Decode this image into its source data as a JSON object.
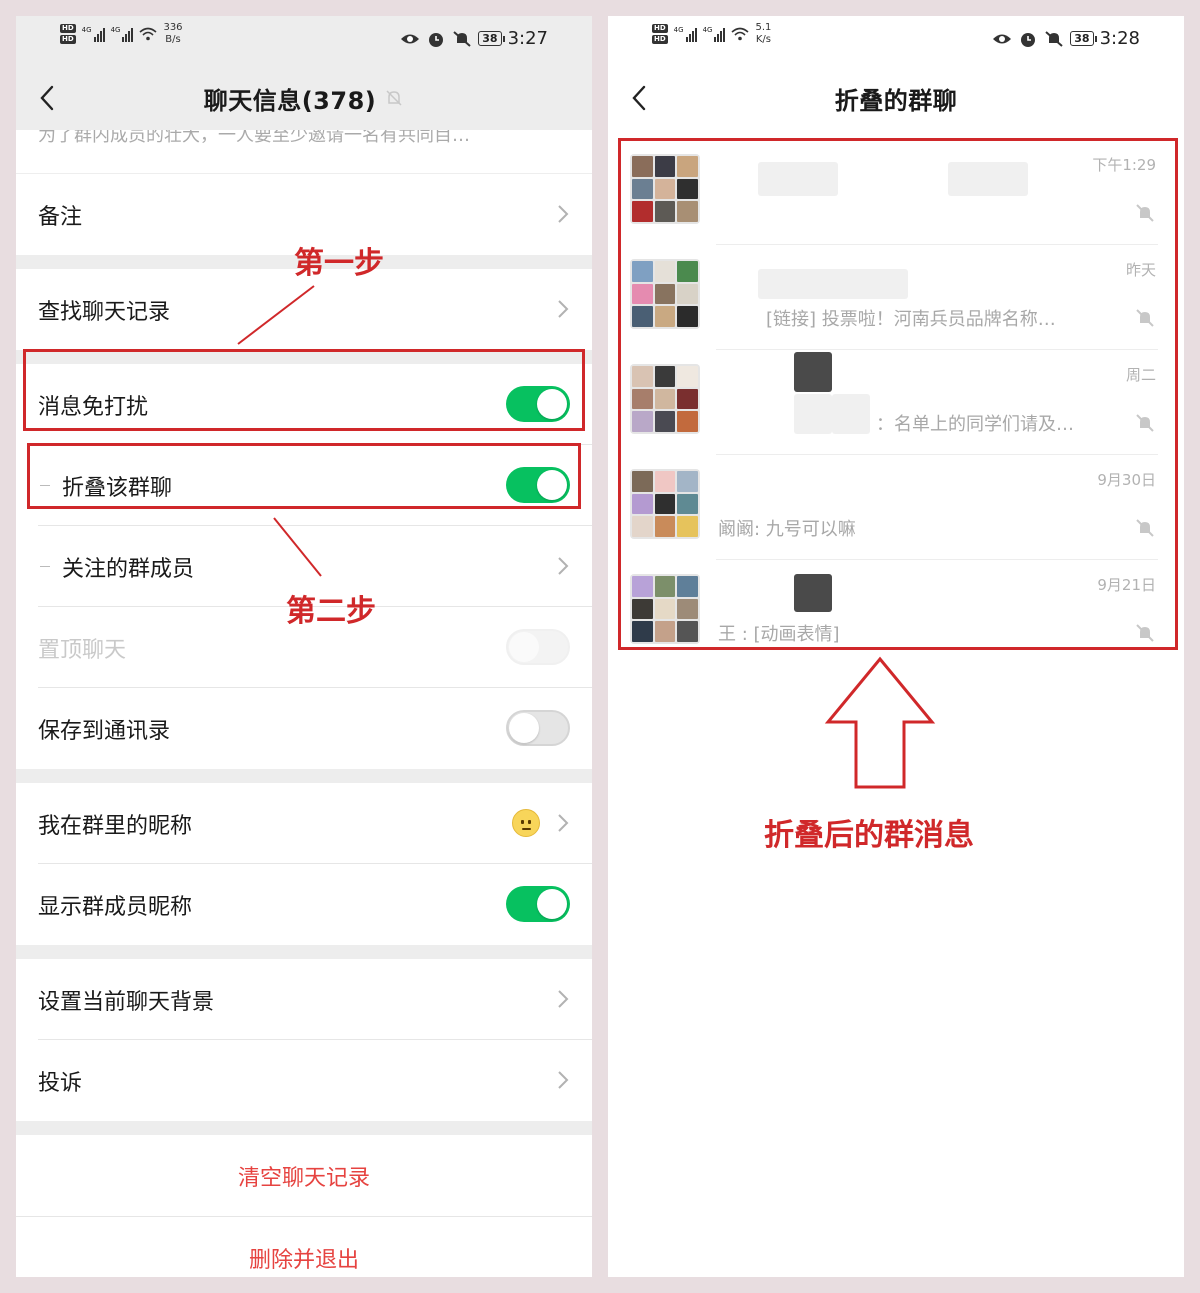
{
  "left": {
    "status": {
      "speed_value": "336",
      "speed_unit": "B/s",
      "time": "3:27",
      "battery": "38",
      "net": "4G"
    },
    "title": "聊天信息(378)",
    "clipped_text": "为了群内成员的壮大，一人要至少邀请一名有共同目…",
    "rows": {
      "remark": "备注",
      "search_history": "查找聊天记录",
      "mute": "消息免打扰",
      "fold": "折叠该群聊",
      "follow_members": "关注的群成员",
      "pin": "置顶聊天",
      "save_contacts": "保存到通讯录",
      "my_nickname": "我在群里的昵称",
      "show_nicknames": "显示群成员昵称",
      "background": "设置当前聊天背景",
      "complain": "投诉",
      "clear": "清空聊天记录",
      "delete_exit": "删除并退出"
    },
    "toggles": {
      "mute": true,
      "fold": true,
      "pin": false,
      "save_contacts": false,
      "show_nicknames": true
    },
    "annotations": {
      "step1": "第一步",
      "step2": "第二步"
    }
  },
  "right": {
    "status": {
      "speed_value": "5.1",
      "speed_unit": "K/s",
      "time": "3:28",
      "battery": "38",
      "net": "4G"
    },
    "title": "折叠的群聊",
    "chats": [
      {
        "time": "下午1:29",
        "preview": ""
      },
      {
        "time": "昨天",
        "preview": "[链接] 投票啦！河南兵员品牌名称…"
      },
      {
        "time": "周二",
        "preview": "：名单上的同学们请及…"
      },
      {
        "time": "9月30日",
        "preview": "阚阚: 九号可以嘛"
      },
      {
        "time": "9月21日",
        "preview": "王 : [动画表情]"
      }
    ],
    "annotation": "折叠后的群消息"
  },
  "colors": {
    "accent_green": "#07c160",
    "annotation_red": "#d0282a",
    "danger_red": "#e64340",
    "page_bg": "#ededed"
  }
}
